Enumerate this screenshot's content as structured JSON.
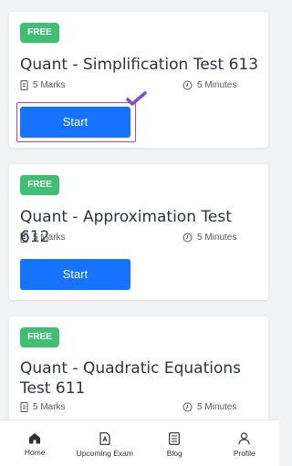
{
  "cards": [
    {
      "badge": "FREE",
      "title": "Quant - Simplification Test 613",
      "marks": "5 Marks",
      "duration": "5 Minutes",
      "button": "Start"
    },
    {
      "badge": "FREE",
      "title": "Quant - Approximation Test 612",
      "marks": "5 Marks",
      "duration": "5 Minutes",
      "button": "Start"
    },
    {
      "badge": "FREE",
      "title": "Quant - Quadratic Equations Test 611",
      "marks": "5 Marks",
      "duration": "5 Minutes"
    }
  ],
  "nav": {
    "items": [
      {
        "label": "Home",
        "icon": "home-icon",
        "active": true
      },
      {
        "label": "Upcoming Exam",
        "icon": "exam-document-icon",
        "active": false
      },
      {
        "label": "Blog",
        "icon": "blog-list-icon",
        "active": false
      },
      {
        "label": "Profile",
        "icon": "profile-icon",
        "active": false
      }
    ]
  },
  "colors": {
    "badge": "#3fbf73",
    "button": "#1673ff",
    "focus_ring": "#c2458f",
    "checkmark": "#7b4fc4"
  }
}
